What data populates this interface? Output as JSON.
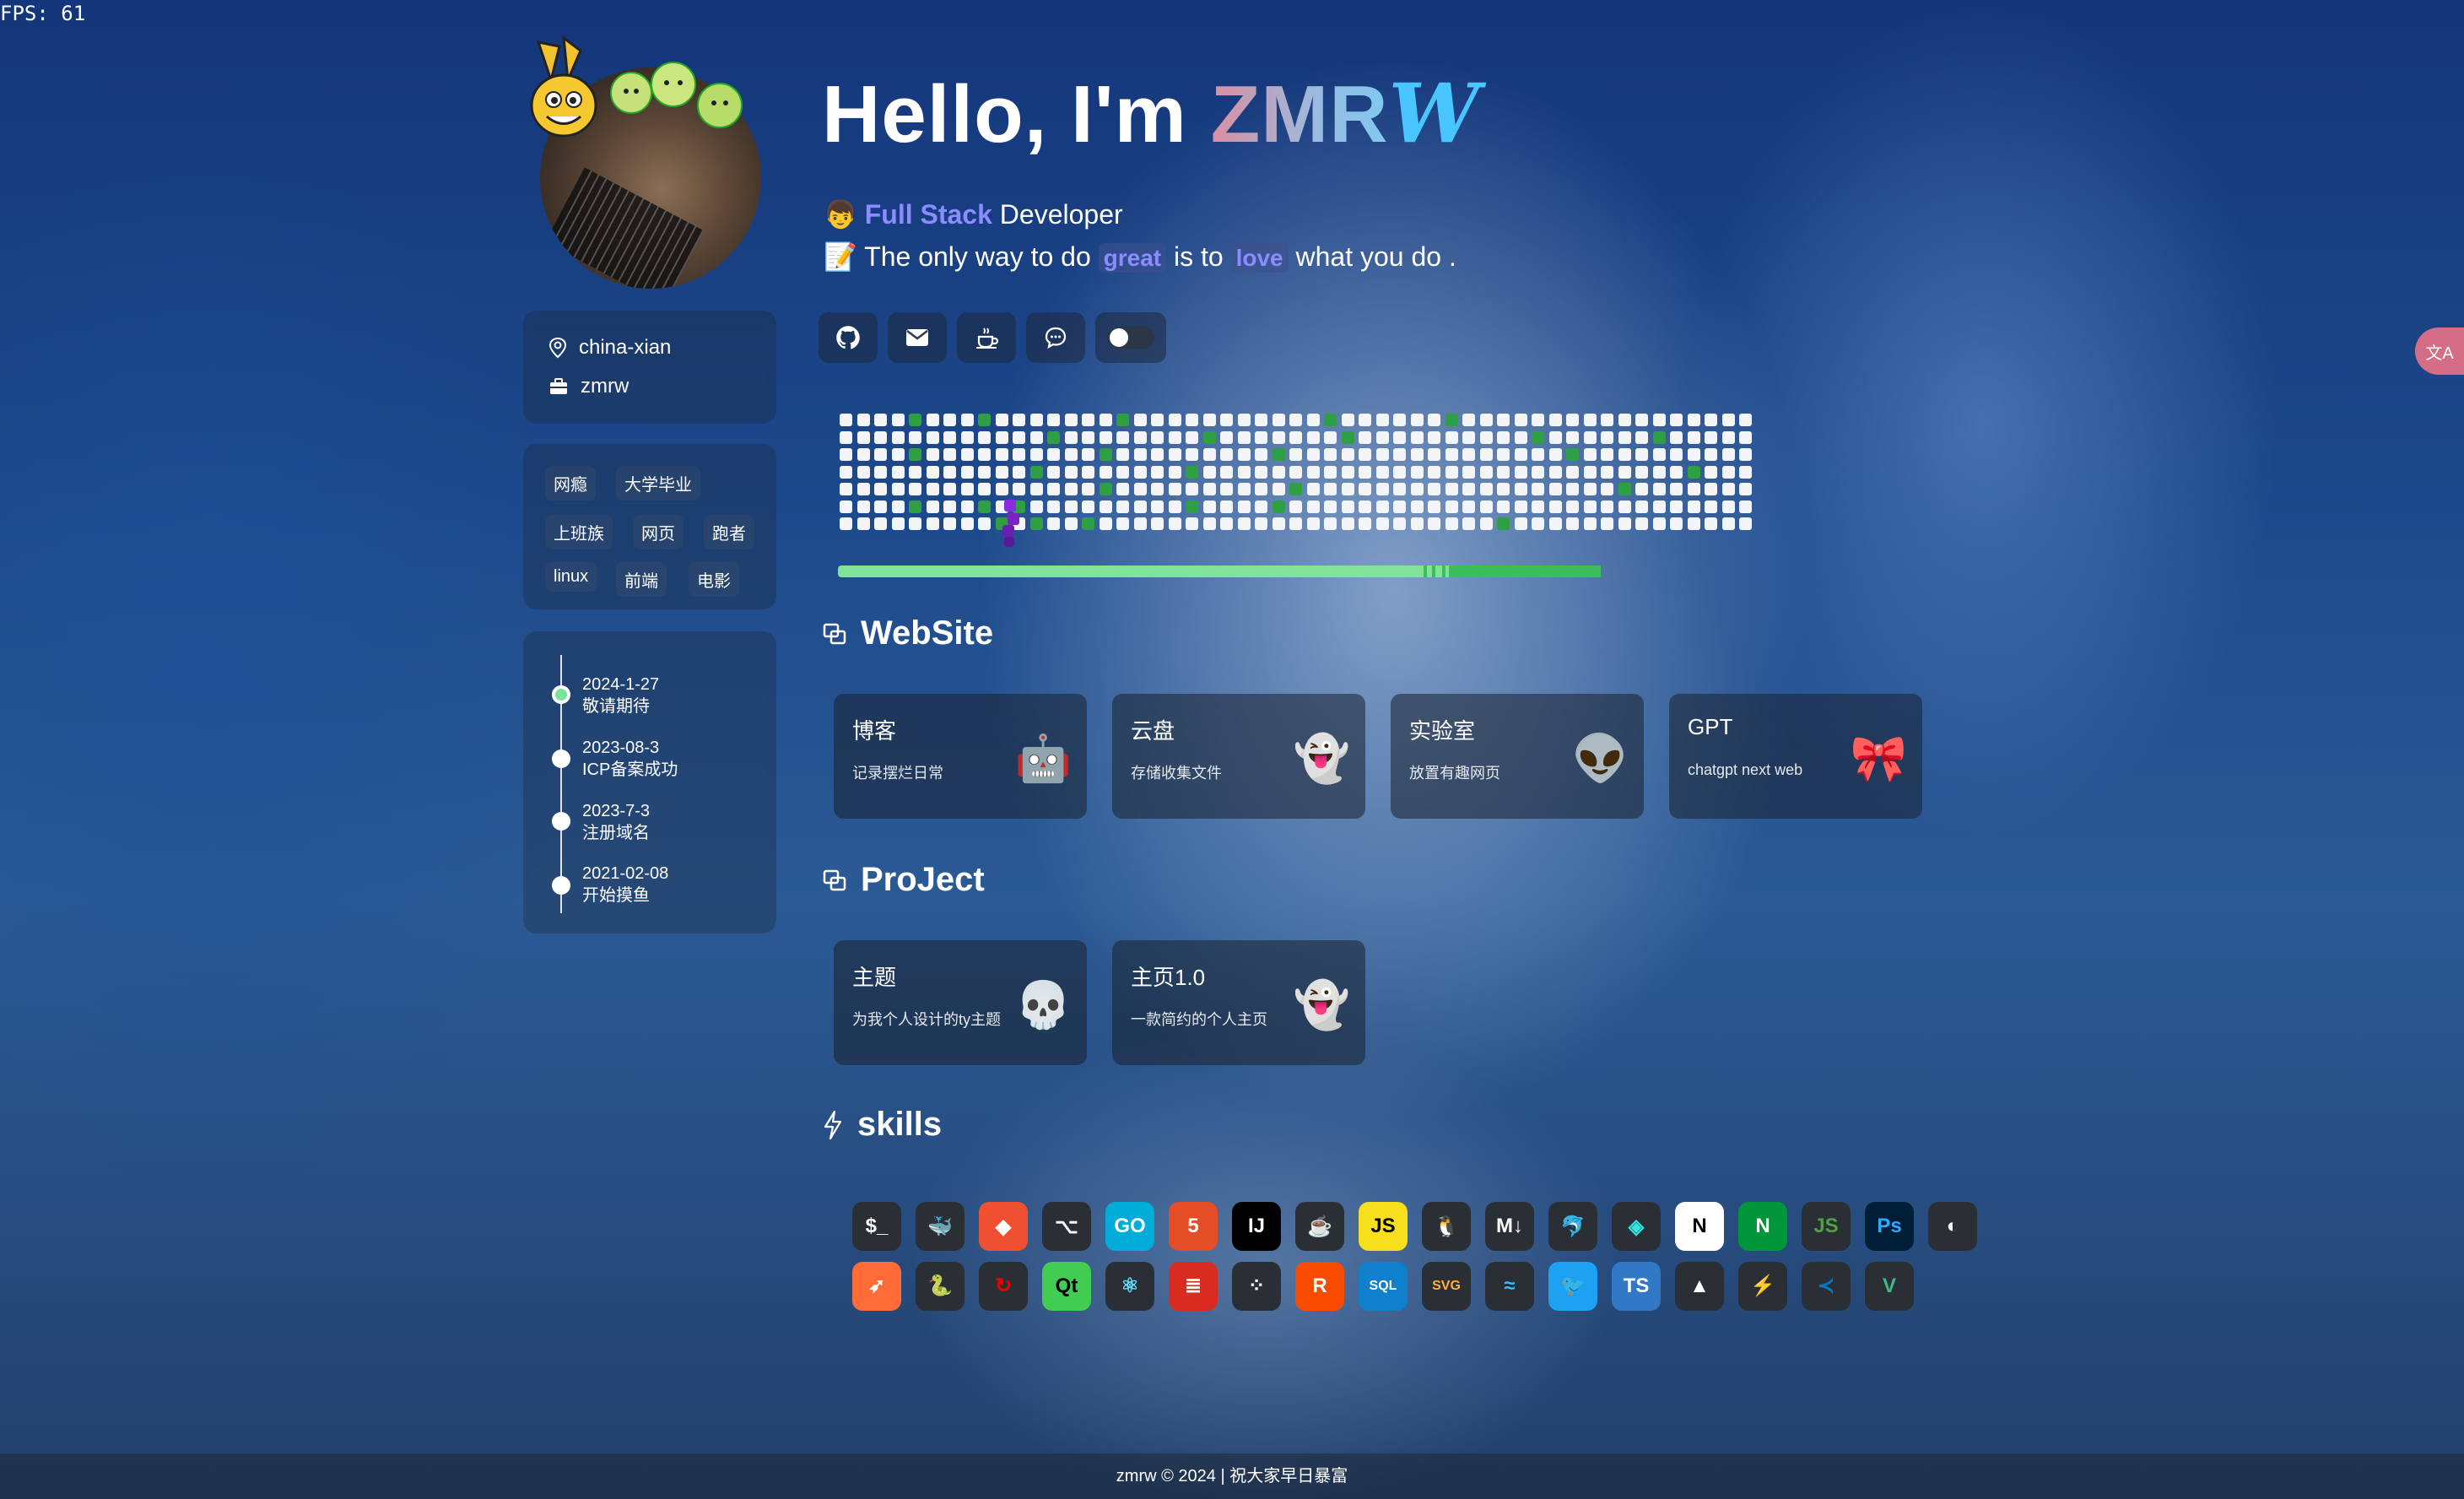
{
  "fps": "FPS: 61",
  "profile": {
    "location": "china-xian",
    "username": "zmrw"
  },
  "tags": [
    "网瘾",
    "大学毕业",
    "上班族",
    "网页",
    "跑者",
    "linux",
    "前端",
    "电影"
  ],
  "timeline": [
    {
      "date": "2024-1-27",
      "text": "敬请期待",
      "active": true
    },
    {
      "date": "2023-08-3",
      "text": "ICP备案成功",
      "active": false
    },
    {
      "date": "2023-7-3",
      "text": "注册域名",
      "active": false
    },
    {
      "date": "2021-02-08",
      "text": "开始摸鱼",
      "active": false
    }
  ],
  "hero": {
    "hello": "Hello, I'm ",
    "name": "ZMR",
    "signature": "W",
    "role_emoji": "👦",
    "role_highlight": "Full Stack",
    "role_rest": " Developer",
    "quote_emoji": "📝",
    "quote_1": "The only way to do ",
    "quote_great": "great",
    "quote_2": " is to ",
    "quote_love": "love",
    "quote_3": " what you do ."
  },
  "social_icons": [
    "github-icon",
    "mail-icon",
    "coffee-icon",
    "chat-icon",
    "theme-toggle"
  ],
  "sections": {
    "website": "WebSite",
    "project": "ProJect",
    "skills": "skills"
  },
  "websites": [
    {
      "title": "博客",
      "desc": "记录摆烂日常",
      "emoji": "🤖"
    },
    {
      "title": "云盘",
      "desc": "存储收集文件",
      "emoji": "👻"
    },
    {
      "title": "实验室",
      "desc": "放置有趣网页",
      "emoji": "👽"
    },
    {
      "title": "GPT",
      "desc": "chatgpt next web",
      "emoji": "🎀"
    }
  ],
  "projects": [
    {
      "title": "主题",
      "desc": "为我个人设计的ty主题",
      "emoji": "💀"
    },
    {
      "title": "主页1.0",
      "desc": "一款简约的个人主页",
      "emoji": "👻"
    }
  ],
  "skills": [
    [
      "bash",
      "docker",
      "git",
      "github",
      "go",
      "html5",
      "idea",
      "java",
      "js",
      "linux",
      "markdown",
      "mysql",
      "netlify",
      "nextjs",
      "nginx",
      "nodejs",
      "photoshop",
      "plausible"
    ],
    [
      "postman",
      "python",
      "redhat",
      "qt",
      "react",
      "redis",
      "raspberrypi",
      "rust",
      "sqlite",
      "svg",
      "tailwind",
      "twitter",
      "ts",
      "vercel",
      "vite",
      "vscode",
      "vue"
    ]
  ],
  "footer": "zmrw © 2024 | 祝大家早日暴富",
  "translate_badge": "文A"
}
